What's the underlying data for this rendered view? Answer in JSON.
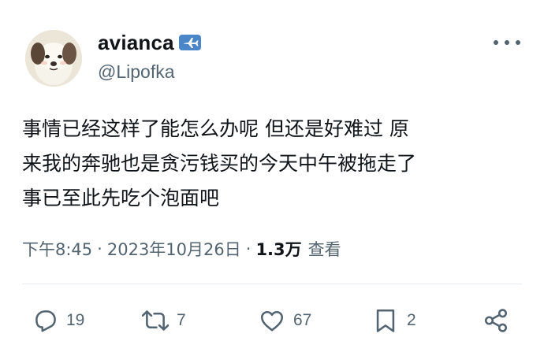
{
  "user": {
    "display_name": "avianca",
    "handle": "@Lipofka",
    "avatar_icon": "dog-cartoon-avatar",
    "badge_icon": "airplane-badge-icon"
  },
  "tweet": {
    "lines": [
      "事情已经这样了能怎么办呢 但还是好难过 原",
      "来我的奔驰也是贪污钱买的今天中午被拖走了",
      "事已至此先吃个泡面吧"
    ]
  },
  "meta": {
    "time": "下午8:45",
    "separator": "·",
    "date": "2023年10月26日",
    "views_count": "1.3万",
    "views_label": "查看"
  },
  "actions": {
    "reply": {
      "icon": "reply-icon",
      "count": "19"
    },
    "retweet": {
      "icon": "retweet-icon",
      "count": "7"
    },
    "like": {
      "icon": "heart-icon",
      "count": "67"
    },
    "bookmark": {
      "icon": "bookmark-icon",
      "count": "2"
    },
    "share": {
      "icon": "share-icon"
    }
  },
  "colors": {
    "text": "#0f1419",
    "secondary": "#536471",
    "badge": "#4a86c8",
    "divider": "#e6ecf0"
  }
}
